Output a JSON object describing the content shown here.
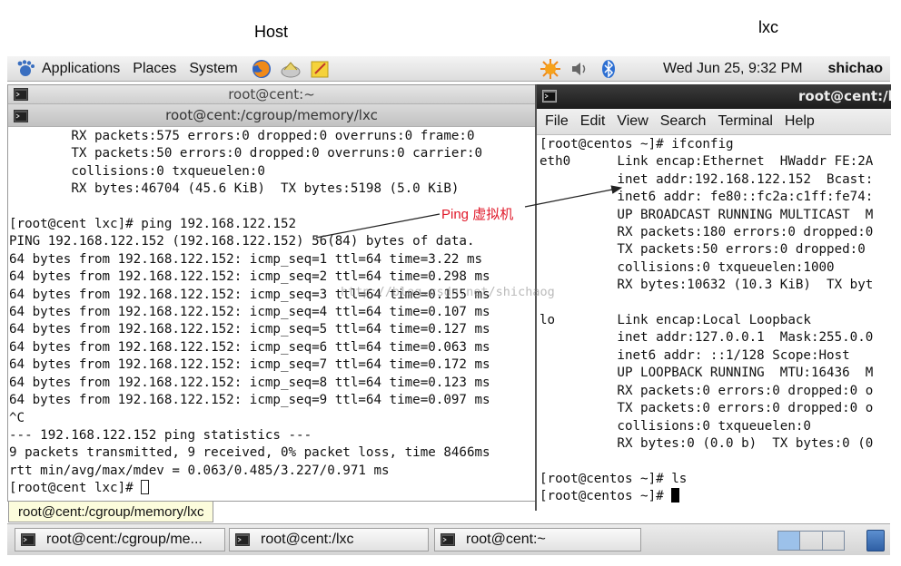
{
  "captions": {
    "host": "Host",
    "lxc": "lxc"
  },
  "top_panel": {
    "menus": [
      "Applications",
      "Places",
      "System"
    ],
    "clock": "Wed Jun 25,  9:32 PM",
    "user": "shichao"
  },
  "host_window": {
    "back_title": "root@cent:~",
    "front_title": "root@cent:/cgroup/memory/lxc",
    "lines": [
      "        RX packets:575 errors:0 dropped:0 overruns:0 frame:0",
      "        TX packets:50 errors:0 dropped:0 overruns:0 carrier:0",
      "        collisions:0 txqueuelen:0",
      "        RX bytes:46704 (45.6 KiB)  TX bytes:5198 (5.0 KiB)",
      "",
      "[root@cent lxc]# ping 192.168.122.152",
      "PING 192.168.122.152 (192.168.122.152) 56(84) bytes of data.",
      "64 bytes from 192.168.122.152: icmp_seq=1 ttl=64 time=3.22 ms",
      "64 bytes from 192.168.122.152: icmp_seq=2 ttl=64 time=0.298 ms",
      "64 bytes from 192.168.122.152: icmp_seq=3 ttl=64 time=0.155 ms",
      "64 bytes from 192.168.122.152: icmp_seq=4 ttl=64 time=0.107 ms",
      "64 bytes from 192.168.122.152: icmp_seq=5 ttl=64 time=0.127 ms",
      "64 bytes from 192.168.122.152: icmp_seq=6 ttl=64 time=0.063 ms",
      "64 bytes from 192.168.122.152: icmp_seq=7 ttl=64 time=0.172 ms",
      "64 bytes from 192.168.122.152: icmp_seq=8 ttl=64 time=0.123 ms",
      "64 bytes from 192.168.122.152: icmp_seq=9 ttl=64 time=0.097 ms",
      "^C",
      "--- 192.168.122.152 ping statistics ---",
      "9 packets transmitted, 9 received, 0% packet loss, time 8466ms",
      "rtt min/avg/max/mdev = 0.063/0.485/3.227/0.971 ms"
    ],
    "prompt": "[root@cent lxc]# "
  },
  "tooltip": "root@cent:/cgroup/memory/lxc",
  "lxc_window": {
    "title": "root@cent:/l",
    "menus": [
      "File",
      "Edit",
      "View",
      "Search",
      "Terminal",
      "Help"
    ],
    "lines": [
      "[root@centos ~]# ifconfig",
      "eth0      Link encap:Ethernet  HWaddr FE:2A",
      "          inet addr:192.168.122.152  Bcast:",
      "          inet6 addr: fe80::fc2a:c1ff:fe74:",
      "          UP BROADCAST RUNNING MULTICAST  M",
      "          RX packets:180 errors:0 dropped:0",
      "          TX packets:50 errors:0 dropped:0 ",
      "          collisions:0 txqueuelen:1000",
      "          RX bytes:10632 (10.3 KiB)  TX byt",
      "",
      "lo        Link encap:Local Loopback",
      "          inet addr:127.0.0.1  Mask:255.0.0",
      "          inet6 addr: ::1/128 Scope:Host",
      "          UP LOOPBACK RUNNING  MTU:16436  M",
      "          RX packets:0 errors:0 dropped:0 o",
      "          TX packets:0 errors:0 dropped:0 o",
      "          collisions:0 txqueuelen:0",
      "          RX bytes:0 (0.0 b)  TX bytes:0 (0",
      "",
      "[root@centos ~]# ls"
    ],
    "prompt": "[root@centos ~]# "
  },
  "taskbar": {
    "items": [
      "root@cent:/cgroup/me...",
      "root@cent:/lxc",
      "root@cent:~"
    ]
  },
  "annotation": {
    "label": "Ping 虚拟机",
    "color": "#e0192a"
  },
  "watermark": "http://blog.csdn.net/shichaog",
  "icons": [
    "gnome-foot-icon",
    "firefox-icon",
    "mail-icon",
    "notes-icon",
    "weather-icon",
    "volume-icon",
    "bluetooth-icon",
    "terminal-icon",
    "trash-icon"
  ]
}
